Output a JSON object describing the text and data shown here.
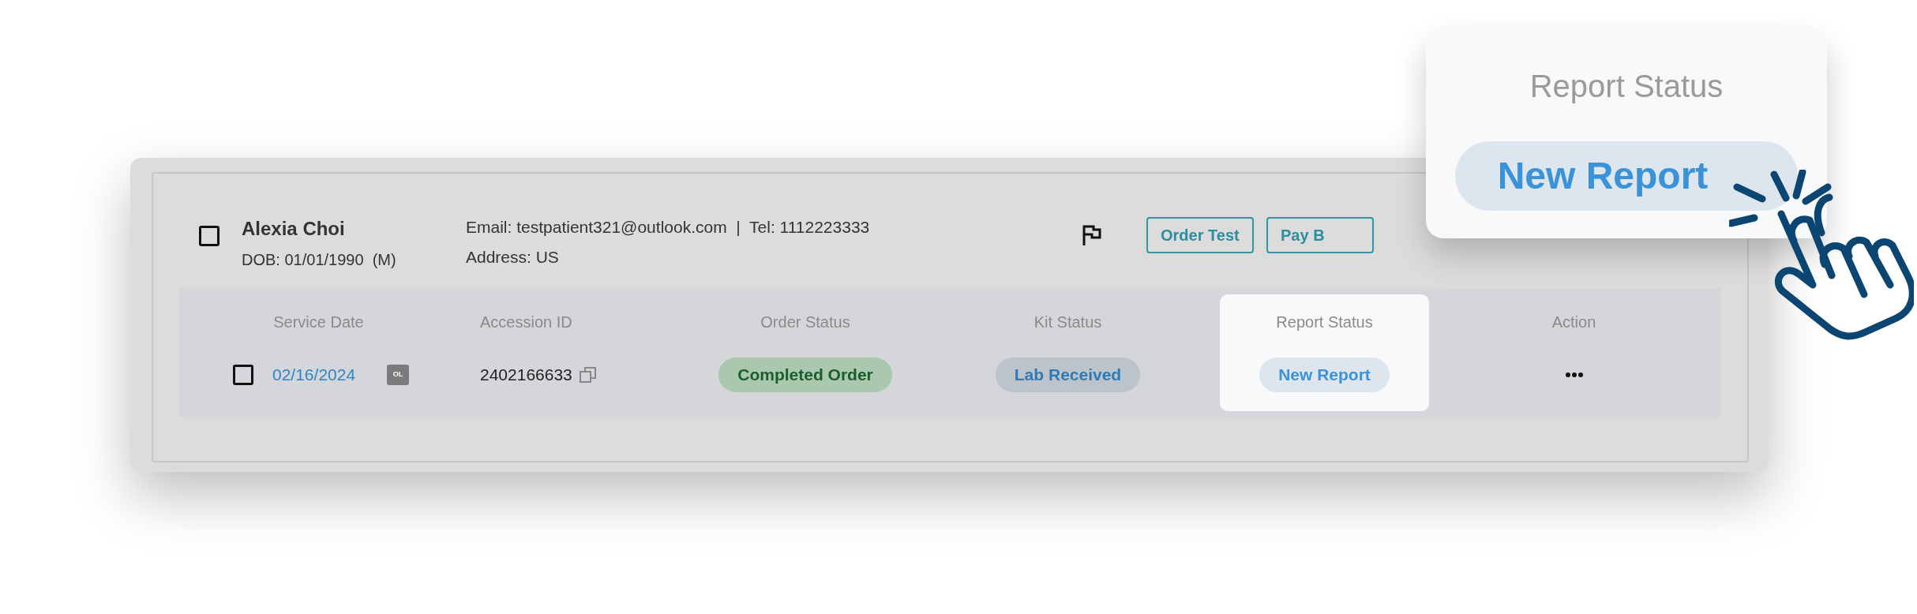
{
  "patient": {
    "selected": false,
    "name": "Alexia Choi",
    "dob": "DOB: 01/01/1990  (M)",
    "contact": "Email: testpatient321@outlook.com  |  Tel: 1112223333",
    "address": "Address: US",
    "actions": [
      "Order Test",
      "Pay B"
    ]
  },
  "table": {
    "columns": [
      {
        "label": "Service Date",
        "highlighted": false
      },
      {
        "label": "Accession ID",
        "highlighted": false
      },
      {
        "label": "Order Status",
        "highlighted": false
      },
      {
        "label": "Kit Status",
        "highlighted": false
      },
      {
        "label": "Report Status",
        "highlighted": true
      },
      {
        "label": "Action",
        "highlighted": false
      }
    ],
    "rows": [
      {
        "selected": false,
        "service_date": "02/16/2024",
        "badge": "OL",
        "accession_id": "2402166633",
        "order_status": {
          "label": "Completed Order",
          "kind": "completed"
        },
        "kit_status": {
          "label": "Lab Received",
          "kind": "received"
        },
        "report_status": {
          "label": "New Report",
          "kind": "new"
        }
      }
    ]
  },
  "callout": {
    "title": "Report Status",
    "button": "New Report"
  }
}
